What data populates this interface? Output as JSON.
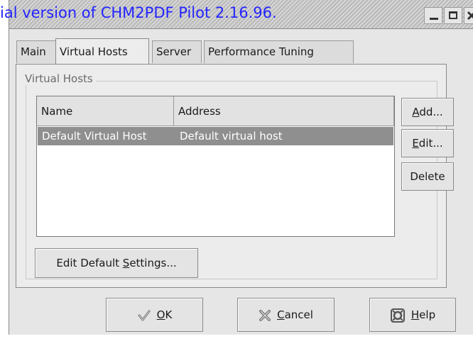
{
  "watermark": "ial version of CHM2PDF Pilot 2.16.96.",
  "tabs": [
    {
      "label": "Main"
    },
    {
      "label": "Virtual Hosts"
    },
    {
      "label": "Server"
    },
    {
      "label": "Performance Tuning"
    }
  ],
  "group_title": "Virtual Hosts",
  "table": {
    "columns": [
      "Name",
      "Address"
    ],
    "rows": [
      {
        "name": "Default Virtual Host",
        "address": "Default virtual host"
      }
    ]
  },
  "side_buttons": {
    "add": {
      "mnemonic": "A",
      "rest": "dd..."
    },
    "edit": {
      "mnemonic": "E",
      "rest": "dit..."
    },
    "delete": "Delete"
  },
  "edit_defaults": {
    "before": "Edit Default ",
    "mnemonic": "S",
    "after": "ettings..."
  },
  "bottom_buttons": {
    "ok": {
      "mnemonic": "O",
      "rest": "K"
    },
    "cancel": {
      "mnemonic": "C",
      "rest": "ancel"
    },
    "help": {
      "mnemonic": "H",
      "rest": "elp"
    }
  },
  "icons": {
    "minimize": "minimize-icon",
    "maximize": "maximize-icon",
    "close": "close-icon",
    "ok": "checkmark-icon",
    "cancel": "x-icon",
    "help": "lifebuoy-icon"
  }
}
